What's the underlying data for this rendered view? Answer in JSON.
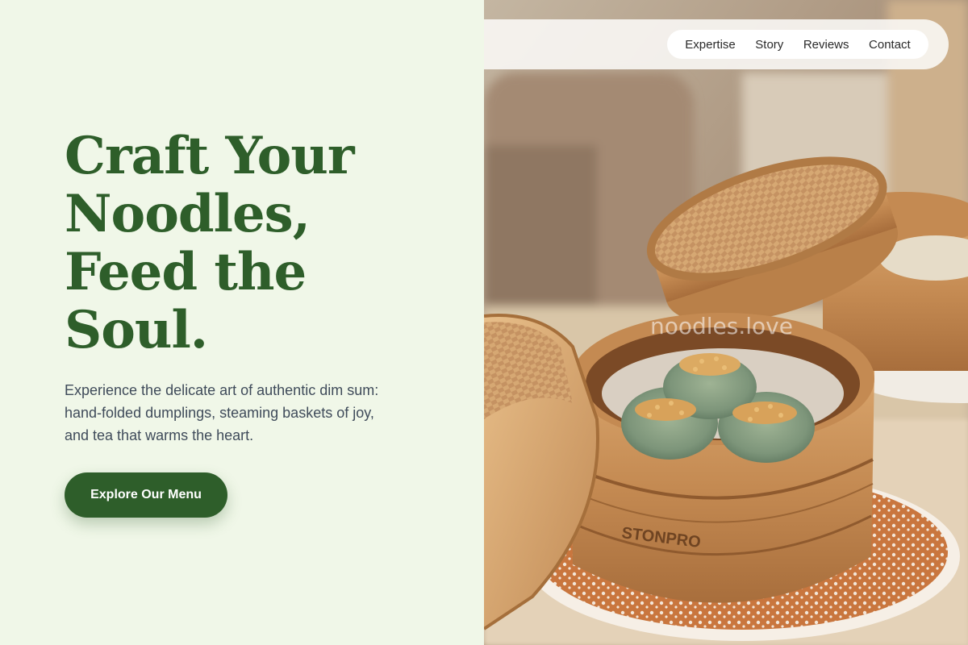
{
  "nav": {
    "links": [
      {
        "label": "Expertise"
      },
      {
        "label": "Story"
      },
      {
        "label": "Reviews"
      },
      {
        "label": "Contact"
      }
    ]
  },
  "hero": {
    "headline_lines": [
      "Craft Your",
      "Noodles,",
      "Feed the",
      "Soul."
    ],
    "description_lines": [
      "Experience the delicate art of authentic dim sum:",
      "hand-folded dumplings, steaming baskets of joy,",
      "and tea that warms the heart."
    ],
    "cta_label": "Explore Our Menu"
  },
  "photo": {
    "watermark": "noodles.love",
    "basket_brand": "STONPRO"
  },
  "colors": {
    "accent": "#2e5e2a",
    "left_background": "#f0f7e8",
    "body_text": "#3f4b5a"
  }
}
